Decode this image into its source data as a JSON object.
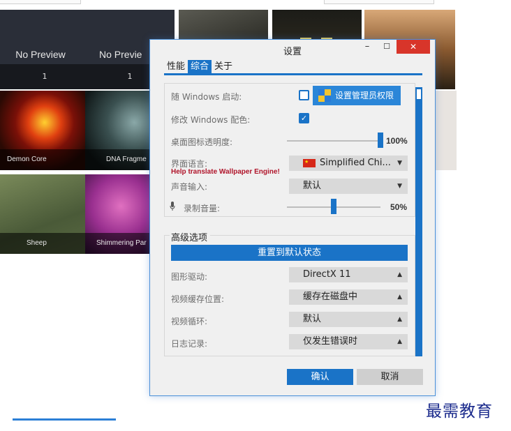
{
  "gallery": {
    "tiles": [
      {
        "text": "No Preview",
        "count": "1"
      },
      {
        "text": "No Previe",
        "count": "1"
      },
      {
        "caption": "Demon Core"
      },
      {
        "caption": "DNA Fragme"
      },
      {
        "caption": "Sheep"
      },
      {
        "caption": "Shimmering Par"
      }
    ]
  },
  "watermark": "最需教育",
  "dialog": {
    "title": "设置",
    "min_icon": "minimize-icon",
    "max_icon": "maximize-icon",
    "close_icon": "close-icon",
    "tabs": [
      "性能",
      "综合",
      "关于"
    ],
    "active_tab": 1,
    "general": {
      "startup_label": "随 Windows 启动:",
      "startup_checked": false,
      "admin_button": "设置管理员权限",
      "admin_icon": "uac-shield-icon",
      "color_label": "修改 Windows 配色:",
      "color_checked": true,
      "icon_opacity_label": "桌面图标透明度:",
      "icon_opacity_value": "100%",
      "icon_opacity_fraction": 1.0,
      "language_label": "界面语言:",
      "translate_link": "Help translate Wallpaper Engine!",
      "language_value": "Simplified Chi...",
      "language_flag": "china-flag-icon",
      "audio_input_label": "声音输入:",
      "audio_input_value": "默认",
      "record_volume_label": "录制音量:",
      "record_volume_icon": "microphone-icon",
      "record_volume_value": "50%",
      "record_volume_fraction": 0.5
    },
    "advanced": {
      "title": "高级选项",
      "reset_button": "重置到默认状态",
      "graphics_label": "图形驱动:",
      "graphics_value": "DirectX 11",
      "cache_label": "视频缓存位置:",
      "cache_value": "缓存在磁盘中",
      "loop_label": "视频循环:",
      "loop_value": "默认",
      "log_label": "日志记录:",
      "log_value": "仅发生错误时"
    },
    "ok_button": "确认",
    "cancel_button": "取消"
  },
  "colors": {
    "accent": "#1a73c7",
    "close": "#d8352a",
    "link_red": "#b0142a"
  }
}
